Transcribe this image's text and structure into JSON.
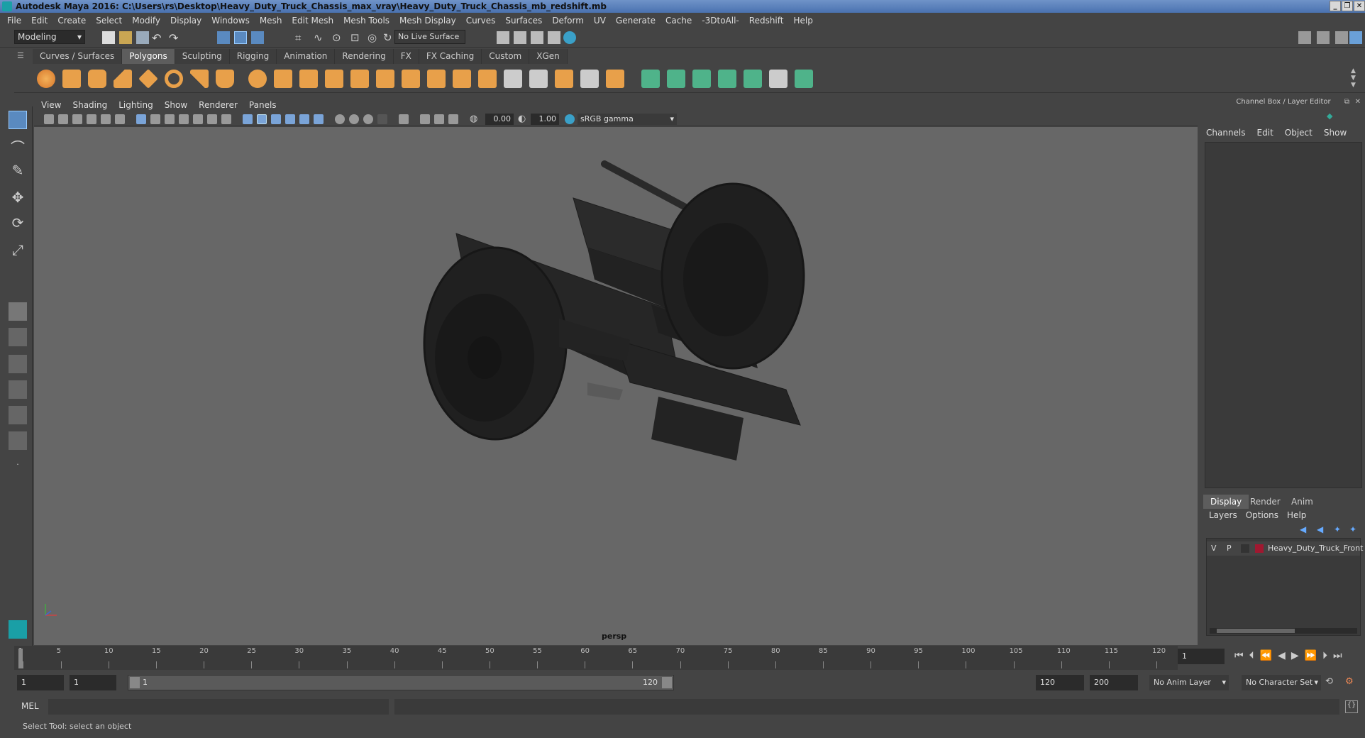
{
  "title": "Autodesk Maya 2016: C:\\Users\\rs\\Desktop\\Heavy_Duty_Truck_Chassis_max_vray\\Heavy_Duty_Truck_Chassis_mb_redshift.mb",
  "menus": [
    "File",
    "Edit",
    "Create",
    "Select",
    "Modify",
    "Display",
    "Windows",
    "Mesh",
    "Edit Mesh",
    "Mesh Tools",
    "Mesh Display",
    "Curves",
    "Surfaces",
    "Deform",
    "UV",
    "Generate",
    "Cache",
    "-3DtoAll-",
    "Redshift",
    "Help"
  ],
  "statusline": {
    "mode": "Modeling",
    "live_surface": "No Live Surface"
  },
  "shelf_tabs": [
    "Curves / Surfaces",
    "Polygons",
    "Sculpting",
    "Rigging",
    "Animation",
    "Rendering",
    "FX",
    "FX Caching",
    "Custom",
    "XGen"
  ],
  "shelf_active": "Polygons",
  "panel_menu": [
    "View",
    "Shading",
    "Lighting",
    "Show",
    "Renderer",
    "Panels"
  ],
  "panel_tools": {
    "exposure": "0.00",
    "gamma": "1.00",
    "color_space": "sRGB gamma"
  },
  "viewport": {
    "camera_label": "persp"
  },
  "channel_box": {
    "header": "Channel Box / Layer Editor",
    "menu": [
      "Channels",
      "Edit",
      "Object",
      "Show"
    ]
  },
  "layer_editor": {
    "tabs": [
      "Display",
      "Render",
      "Anim"
    ],
    "menu": [
      "Layers",
      "Options",
      "Help"
    ],
    "layer": {
      "v": "V",
      "p": "P",
      "name": "Heavy_Duty_Truck_Front",
      "color": "#a01830"
    }
  },
  "timeline": {
    "ticks": [
      "1",
      "5",
      "10",
      "15",
      "20",
      "25",
      "30",
      "35",
      "40",
      "45",
      "50",
      "55",
      "60",
      "65",
      "70",
      "75",
      "80",
      "85",
      "90",
      "95",
      "100",
      "105",
      "110",
      "115",
      "120"
    ],
    "current_frame": "1"
  },
  "range": {
    "start": "1",
    "playback_start": "1",
    "slider_start": "1",
    "slider_end": "120",
    "playback_end": "120",
    "end": "200",
    "anim_layer": "No Anim Layer",
    "character_set": "No Character Set"
  },
  "cmdline": {
    "label": "MEL"
  },
  "helpline": "Select Tool: select an object"
}
